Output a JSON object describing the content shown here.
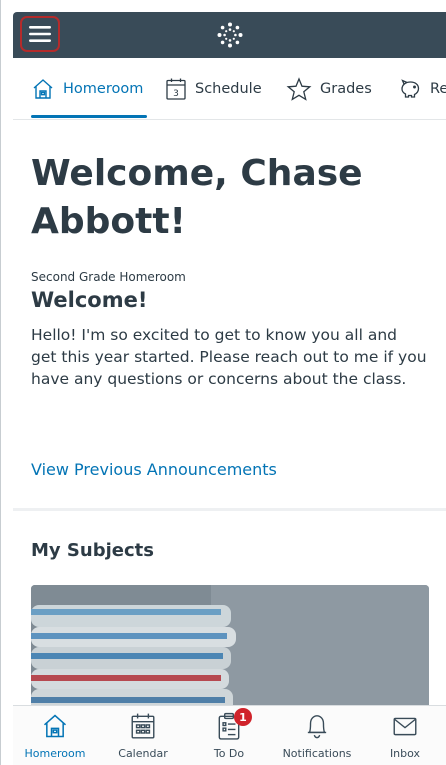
{
  "tabs": [
    {
      "label": "Homeroom",
      "icon": "home-icon",
      "active": true
    },
    {
      "label": "Schedule",
      "icon": "calendar-day-icon",
      "day": "3"
    },
    {
      "label": "Grades",
      "icon": "star-icon"
    },
    {
      "label": "Re",
      "icon": "piggy-bank-icon"
    }
  ],
  "main": {
    "welcome_heading": "Welcome, Chase Abbott!",
    "course_name": "Second Grade Homeroom",
    "announcement_title": "Welcome!",
    "announcement_body": "Hello! I'm so excited to get to know you all and get this year started. Please reach out to me if you have any questions or concerns about the class.",
    "previous_link": "View Previous Announcements",
    "subjects_heading": "My Subjects"
  },
  "bottom_nav": [
    {
      "label": "Homeroom",
      "icon": "home-icon",
      "active": true
    },
    {
      "label": "Calendar",
      "icon": "calendar-icon"
    },
    {
      "label": "To Do",
      "icon": "todo-clipboard-icon",
      "badge": "1"
    },
    {
      "label": "Notifications",
      "icon": "bell-icon"
    },
    {
      "label": "Inbox",
      "icon": "envelope-icon"
    }
  ],
  "colors": {
    "nav_bar": "#394b58",
    "accent": "#0374b5",
    "highlight_box": "#b42b2b",
    "badge": "#d0232b"
  }
}
